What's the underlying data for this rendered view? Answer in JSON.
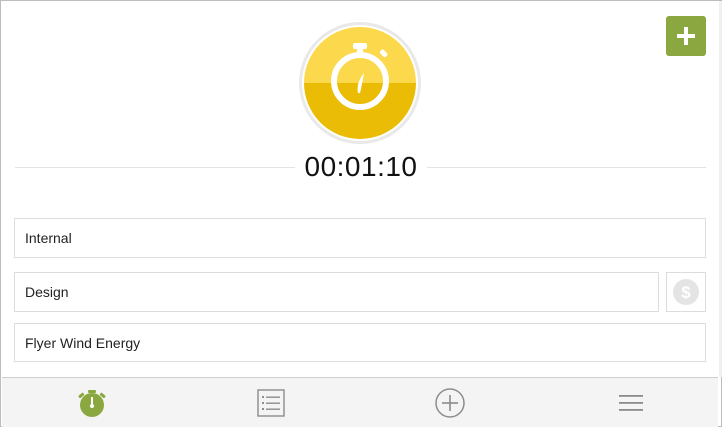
{
  "timer": {
    "elapsed": "00:01:10",
    "running": false,
    "colors": {
      "top": "#fcd84d",
      "bottom": "#ebbc06",
      "ring": "#f2f2f2"
    }
  },
  "header": {
    "add_icon": "plus-icon",
    "accent": "#8aa83f"
  },
  "fields": {
    "client": "Internal",
    "task": "Design",
    "project": "Flyer Wind Energy",
    "billable_icon": "dollar-circle-icon"
  },
  "nav": {
    "items": [
      {
        "icon": "stopwatch-icon",
        "active": true
      },
      {
        "icon": "list-icon",
        "active": false
      },
      {
        "icon": "add-circle-icon",
        "active": false
      },
      {
        "icon": "hamburger-menu-icon",
        "active": false
      }
    ]
  }
}
